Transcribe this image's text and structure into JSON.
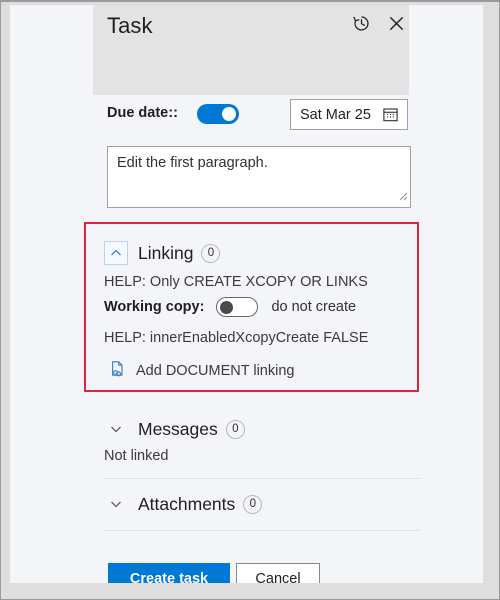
{
  "header": {
    "title": "Task",
    "history_icon": "history-clock-icon",
    "close_icon": "close-icon"
  },
  "due_date": {
    "label": "Due date::",
    "toggle_on": true,
    "date_value": "Sat Mar 25",
    "calendar_icon": "calendar-icon"
  },
  "description": {
    "value": "Edit the first paragraph.",
    "placeholder": "Edit the first paragraph."
  },
  "sections": {
    "linking": {
      "title": "Linking",
      "count": "0",
      "expanded": true,
      "chevron_icon": "chevron-up-icon",
      "help_top": "HELP: Only CREATE XCOPY OR LINKS",
      "working_copy_label": "Working copy:",
      "working_copy_state": "do not create",
      "working_copy_toggle_on": false,
      "help_bottom": "HELP: innerEnabledXcopyCreate FALSE",
      "add_link_label": "Add DOCUMENT linking",
      "add_link_icon": "document-link-icon"
    },
    "messages": {
      "title": "Messages",
      "count": "0",
      "expanded": false,
      "chevron_icon": "chevron-down-icon",
      "status": "Not linked"
    },
    "attachments": {
      "title": "Attachments",
      "count": "0",
      "expanded": false,
      "chevron_icon": "chevron-down-icon"
    }
  },
  "footer": {
    "create_label": "Create task",
    "cancel_label": "Cancel"
  },
  "colors": {
    "accent": "#0078d4",
    "highlight": "#e0243f",
    "header_bg": "#e3e3e3",
    "panel_bg": "#f4f5f9"
  }
}
